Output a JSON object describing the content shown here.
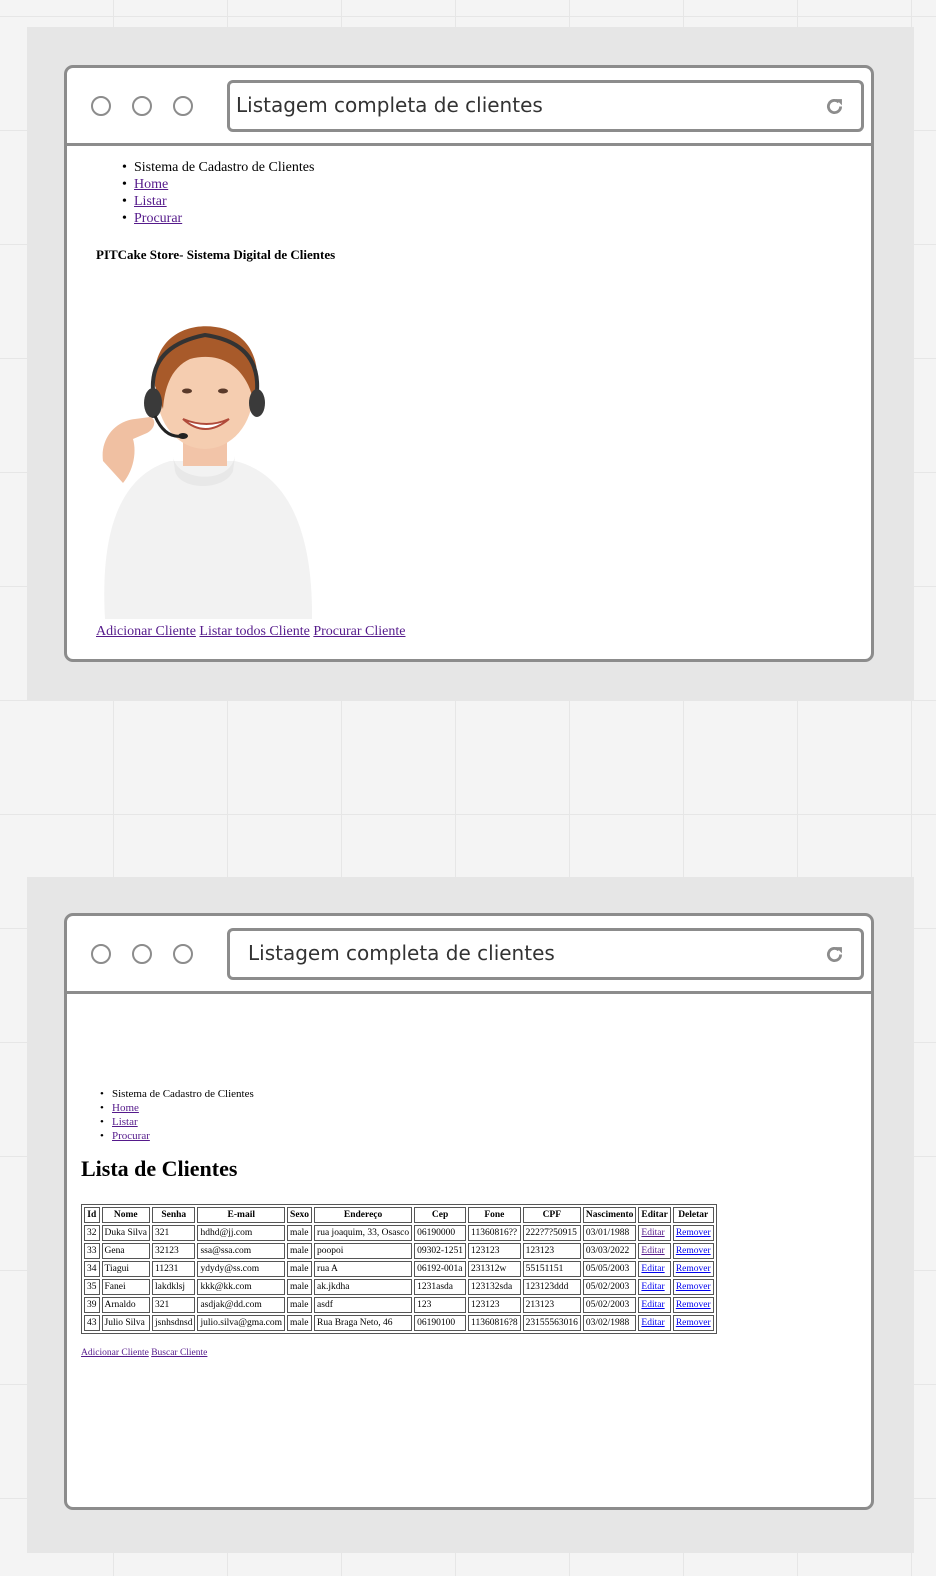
{
  "window1": {
    "url": "Listagem completa de clientes",
    "nav": [
      "Sistema de Cadastro de Clientes",
      "Home",
      "Listar",
      "Procurar"
    ],
    "store_title": "PITCake Store- Sistema Digital de Clientes",
    "actions": [
      "Adicionar Cliente",
      "Listar todos Cliente",
      "Procurar Cliente"
    ]
  },
  "window2": {
    "url": "Listagem completa de clientes",
    "nav": [
      "Sistema de Cadastro de Clientes",
      "Home",
      "Listar",
      "Procurar"
    ],
    "page_title": "Lista de Clientes",
    "table": {
      "headers": [
        "Id",
        "Nome",
        "Senha",
        "E-mail",
        "Sexo",
        "Endereço",
        "Cep",
        "Fone",
        "CPF",
        "Nascimento",
        "Editar",
        "Deletar"
      ],
      "rows": [
        [
          "32",
          "Duka Silva",
          "321",
          "hdhd@jj.com",
          "male",
          "rua joaquim, 33, Osasco",
          "06190000",
          "11360816??",
          "222?7?50915",
          "03/01/1988",
          "Editar",
          "Remover"
        ],
        [
          "33",
          "Gena",
          "32123",
          "ssa@ssa.com",
          "male",
          "poopoi",
          "09302-1251",
          "123123",
          "123123",
          "03/03/2022",
          "Editar",
          "Remover"
        ],
        [
          "34",
          "Tiagui",
          "11231",
          "ydydy@ss.com",
          "male",
          "rua A",
          "06192-001a",
          "231312w",
          "55151151",
          "05/05/2003",
          "Editar",
          "Remover"
        ],
        [
          "35",
          "Fanei",
          "lakdklsj",
          "kkk@kk.com",
          "male",
          "ak.jkdha",
          "1231asda",
          "123132sda",
          "123123ddd",
          "05/02/2003",
          "Editar",
          "Remover"
        ],
        [
          "39",
          "Arnaldo",
          "321",
          "asdjak@dd.com",
          "male",
          "asdf",
          "123",
          "123123",
          "213123",
          "05/02/2003",
          "Editar",
          "Remover"
        ],
        [
          "43",
          "Julio Silva",
          "jsnhsdnsd",
          "julio.silva@gma.com",
          "male",
          "Rua Braga Neto, 46",
          "06190100",
          "11360816?8",
          "23155563016",
          "03/02/1988",
          "Editar",
          "Remover"
        ]
      ]
    },
    "actions": [
      "Adicionar Cliente",
      "Buscar Cliente"
    ]
  }
}
